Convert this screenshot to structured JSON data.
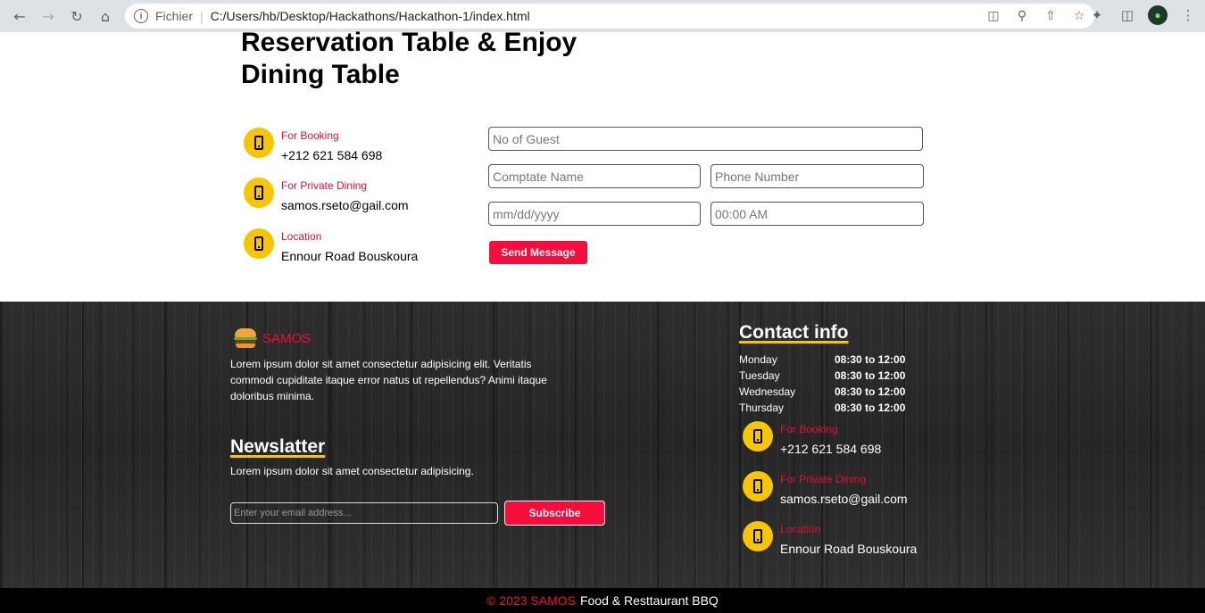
{
  "browser": {
    "scheme_label": "Fichier",
    "url": "C:/Users/hb/Desktop/Hackathons/Hackathon-1/index.html"
  },
  "reservation": {
    "title": "Reservation Table & Enjoy Dining Table",
    "contacts": [
      {
        "label": "For Booking",
        "value": "+212 621 584 698"
      },
      {
        "label": "For Private Dining",
        "value": "samos.rseto@gail.com"
      },
      {
        "label": "Location",
        "value": "Ennour Road Bouskoura"
      }
    ],
    "form": {
      "guests_placeholder": "No of Guest",
      "name_placeholder": "Comptate Name",
      "phone_placeholder": "Phone Number",
      "date_placeholder": "mm/dd/yyyy",
      "time_placeholder": "00:00 AM",
      "submit_label": "Send Message"
    }
  },
  "footer": {
    "brand": "SAMOS",
    "description": "Lorem ipsum dolor sit amet consectetur adipisicing elit. Veritatis commodi cupiditate itaque error natus ut repellendus? Animi itaque doloribus minima.",
    "newsletter": {
      "heading": "Newslatter",
      "description": "Lorem ipsum dolor sit amet consectetur adipisicing.",
      "email_placeholder": "Enter your email address...",
      "subscribe_label": "Subscribe"
    },
    "contact": {
      "heading": "Contact info",
      "hours": [
        {
          "day": "Monday",
          "time": "08:30 to 12:00"
        },
        {
          "day": "Tuesday",
          "time": "08:30 to 12:00"
        },
        {
          "day": "Wednesday",
          "time": "08:30 to 12:00"
        },
        {
          "day": "Thursday",
          "time": "08:30 to 12:00"
        }
      ],
      "items": [
        {
          "label": "For Booking",
          "value": "+212 621 584 698"
        },
        {
          "label": "For Private Dining",
          "value": "samos.rseto@gail.com"
        },
        {
          "label": "Location",
          "value": "Ennour Road Bouskoura"
        }
      ]
    },
    "copyright_red": "© 2023 SAMOS",
    "copyright_white": "Food & Resttaurant BBQ"
  },
  "colors": {
    "accent_red": "#f50d3b",
    "accent_yellow": "#f7c600"
  }
}
